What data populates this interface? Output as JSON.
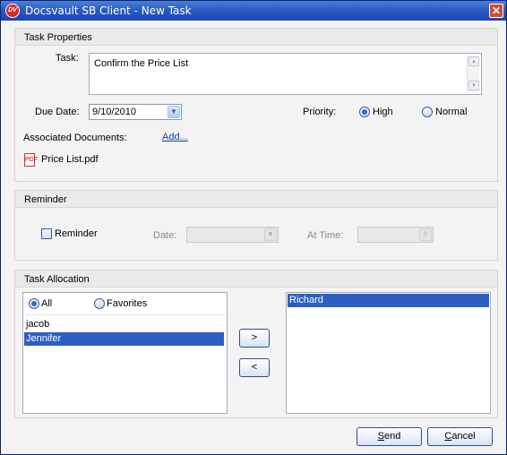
{
  "window": {
    "logo_text": "DV",
    "title": "Docsvault SB Client - New Task",
    "close_glyph": "✕"
  },
  "task_properties": {
    "header": "Task Properties",
    "task_label": "Task:",
    "task_value": "Confirm the Price List",
    "due_date_label": "Due Date:",
    "due_date_value": "9/10/2010",
    "priority_label": "Priority:",
    "priority_options": [
      "High",
      "Normal"
    ],
    "priority_selected": "High",
    "associated_label": "Associated Documents:",
    "add_link": "Add...",
    "documents": [
      "Price List.pdf"
    ]
  },
  "reminder": {
    "header": "Reminder",
    "checkbox_label": "Reminder",
    "checked": false,
    "date_label": "Date:",
    "time_label": "At Time:"
  },
  "allocation": {
    "header": "Task Allocation",
    "filter_options": [
      "All",
      "Favorites"
    ],
    "filter_selected": "All",
    "available_users": [
      "jacob",
      "Jennifer"
    ],
    "selected_available": "Jennifer",
    "add_button": ">",
    "remove_button": "<",
    "assigned_users": [
      "Richard"
    ]
  },
  "footer": {
    "send_prefix": "",
    "send_mnemonic": "S",
    "send_rest": "end",
    "cancel_mnemonic": "C",
    "cancel_rest": "ancel"
  },
  "icons": {
    "pdf": "pdf-icon",
    "dropdown": "chevron-down-icon"
  }
}
